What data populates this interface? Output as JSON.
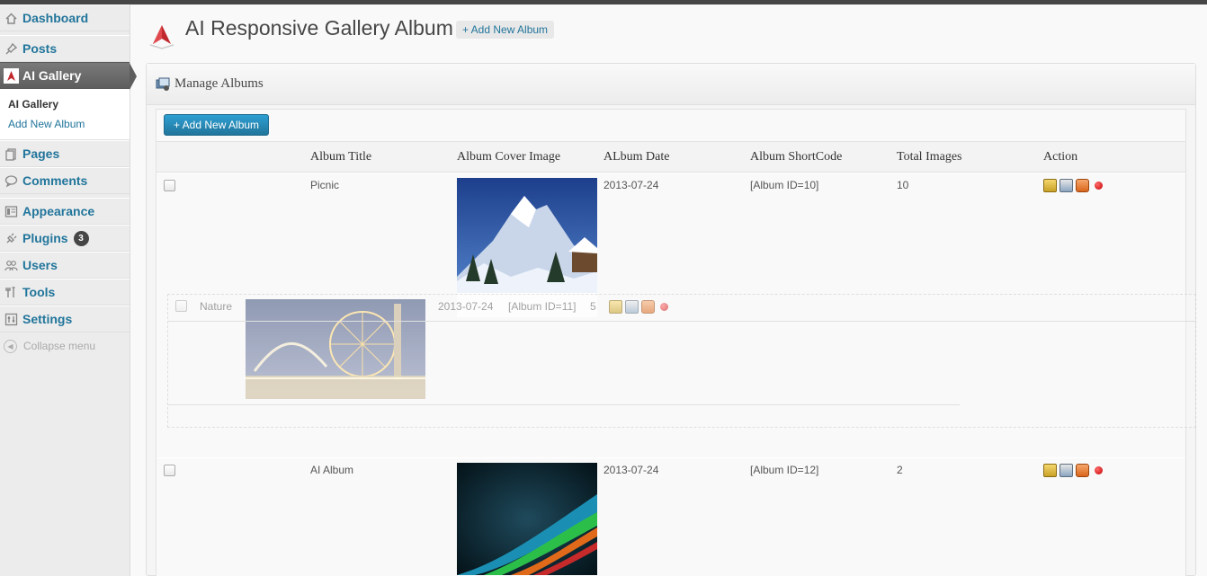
{
  "sidebar": {
    "items": [
      {
        "label": "Dashboard"
      },
      {
        "label": "Posts"
      },
      {
        "label": "AI Gallery"
      },
      {
        "label": "Pages"
      },
      {
        "label": "Comments"
      },
      {
        "label": "Appearance"
      },
      {
        "label": "Plugins",
        "badge": "3"
      },
      {
        "label": "Users"
      },
      {
        "label": "Tools"
      },
      {
        "label": "Settings"
      }
    ],
    "submenu": [
      "AI Gallery",
      "Add New Album"
    ],
    "collapse_label": "Collapse menu"
  },
  "header": {
    "title": "AI Responsive Gallery Album",
    "add_new_label": "+ Add New Album"
  },
  "panel": {
    "title": "Manage Albums",
    "add_button_label": "+ Add New Album"
  },
  "table": {
    "columns": [
      "Album Title",
      "Album Cover Image",
      "ALbum Date",
      "Album ShortCode",
      "Total Images",
      "Action"
    ],
    "rows": [
      {
        "title": "Picnic",
        "date": "2013-07-24",
        "shortcode": "[Album ID=10]",
        "total": "10"
      },
      {
        "title": "Nature",
        "date": "2013-07-24",
        "shortcode": "[Album ID=11]",
        "total": "5"
      },
      {
        "title": "AI Album",
        "date": "2013-07-24",
        "shortcode": "[Album ID=12]",
        "total": "2"
      }
    ]
  },
  "colors": {
    "link": "#21759b",
    "current_menu_bg": "#6a6a6a",
    "primary_button": "#21759b",
    "logo_red": "#c0282e"
  },
  "icons": [
    "home-icon",
    "pin-icon",
    "gallery-logo-icon",
    "pages-icon",
    "comments-icon",
    "appearance-icon",
    "plugins-icon",
    "users-icon",
    "tools-icon",
    "settings-icon",
    "collapse-icon",
    "manage-albums-icon",
    "edit-album-icon",
    "add-images-icon",
    "delete-album-icon",
    "stop-icon"
  ]
}
